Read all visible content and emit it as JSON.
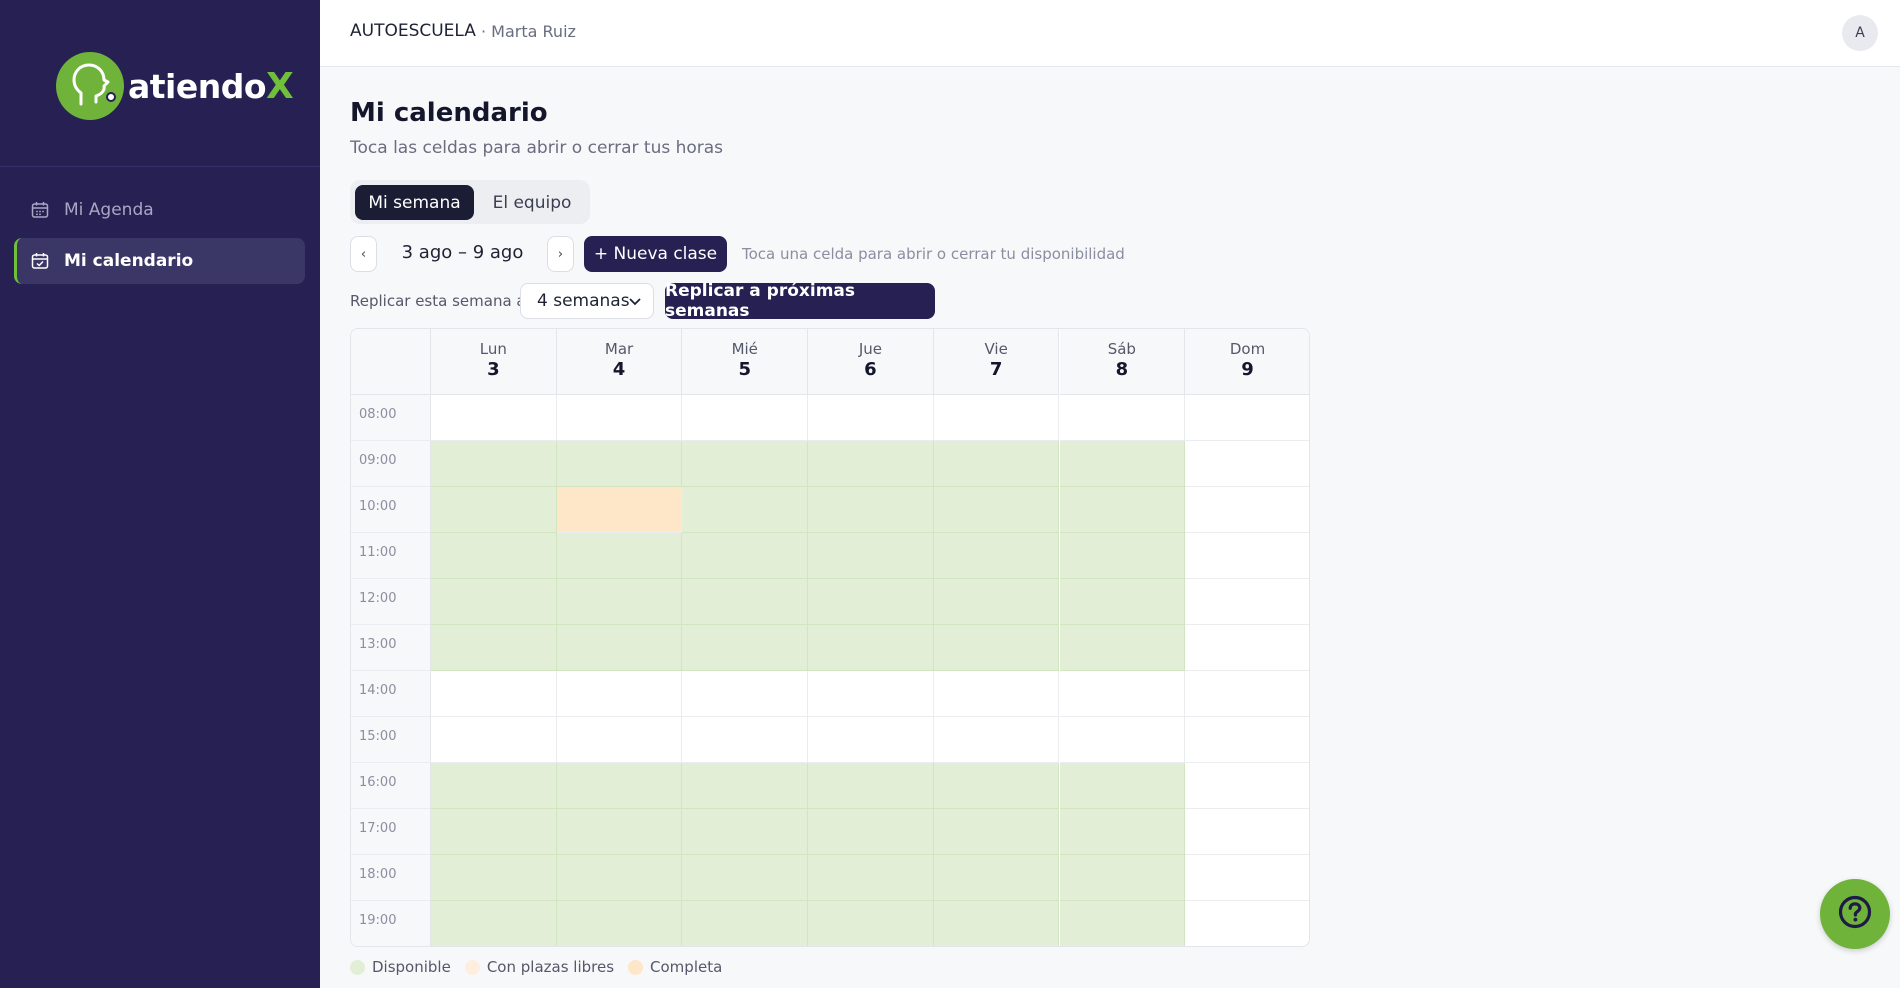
{
  "brand": {
    "name": "atiendo",
    "suffix": "X",
    "color": "#6fb33a",
    "sidebar_bg": "#262152"
  },
  "sidebar": {
    "items": [
      {
        "label": "Mi Agenda",
        "icon": "calendar-icon",
        "active": false
      },
      {
        "label": "Mi calendario",
        "icon": "calendar-check-icon",
        "active": true
      }
    ]
  },
  "header": {
    "org": "AUTOESCUELA",
    "user": "· Marta Ruiz",
    "avatar": "A"
  },
  "page": {
    "title": "Mi calendario",
    "subtitle": "Toca las celdas para abrir o cerrar tus horas"
  },
  "tabs": [
    {
      "label": "Mi semana",
      "active": true
    },
    {
      "label": "El equipo",
      "active": false
    }
  ],
  "toolbar": {
    "prev": "‹",
    "next": "›",
    "range": "3 ago – 9 ago",
    "new_class": "+ Nueva clase",
    "hint": "Toca una celda para abrir o cerrar tu disponibilidad"
  },
  "replicate": {
    "label": "Replicar esta semana a",
    "selected": "4 semanas",
    "button": "Replicar a próximas semanas"
  },
  "calendar": {
    "days": [
      {
        "name": "Lun",
        "num": "3"
      },
      {
        "name": "Mar",
        "num": "4"
      },
      {
        "name": "Mié",
        "num": "5"
      },
      {
        "name": "Jue",
        "num": "6"
      },
      {
        "name": "Vie",
        "num": "7"
      },
      {
        "name": "Sáb",
        "num": "8"
      },
      {
        "name": "Dom",
        "num": "9"
      }
    ],
    "hours": [
      "08:00",
      "09:00",
      "10:00",
      "11:00",
      "12:00",
      "13:00",
      "14:00",
      "15:00",
      "16:00",
      "17:00",
      "18:00",
      "19:00"
    ],
    "status_rows": [
      [
        "empty",
        "empty",
        "empty",
        "empty",
        "empty",
        "empty",
        "empty"
      ],
      [
        "avail",
        "avail",
        "avail",
        "avail",
        "avail",
        "avail",
        "empty"
      ],
      [
        "avail",
        "full",
        "avail",
        "avail",
        "avail",
        "avail",
        "empty"
      ],
      [
        "avail",
        "avail",
        "avail",
        "avail",
        "avail",
        "avail",
        "empty"
      ],
      [
        "avail",
        "avail",
        "avail",
        "avail",
        "avail",
        "avail",
        "empty"
      ],
      [
        "avail",
        "avail",
        "avail",
        "avail",
        "avail",
        "avail",
        "empty"
      ],
      [
        "empty",
        "empty",
        "empty",
        "empty",
        "empty",
        "empty",
        "empty"
      ],
      [
        "empty",
        "empty",
        "empty",
        "empty",
        "empty",
        "empty",
        "empty"
      ],
      [
        "avail",
        "avail",
        "avail",
        "avail",
        "avail",
        "avail",
        "empty"
      ],
      [
        "avail",
        "avail",
        "avail",
        "avail",
        "avail",
        "avail",
        "empty"
      ],
      [
        "avail",
        "avail",
        "avail",
        "avail",
        "avail",
        "avail",
        "empty"
      ],
      [
        "avail",
        "avail",
        "avail",
        "avail",
        "avail",
        "avail",
        "empty"
      ]
    ],
    "colors": {
      "avail": "#e2efd6",
      "partial": "#fdeedd",
      "full": "#fde7c8"
    }
  },
  "legend": [
    {
      "label": "Disponible",
      "color": "#e2efd6"
    },
    {
      "label": "Con plazas libres",
      "color": "#fdeedd"
    },
    {
      "label": "Completa",
      "color": "#fde7c8"
    }
  ],
  "help": {
    "icon": "help-icon"
  }
}
